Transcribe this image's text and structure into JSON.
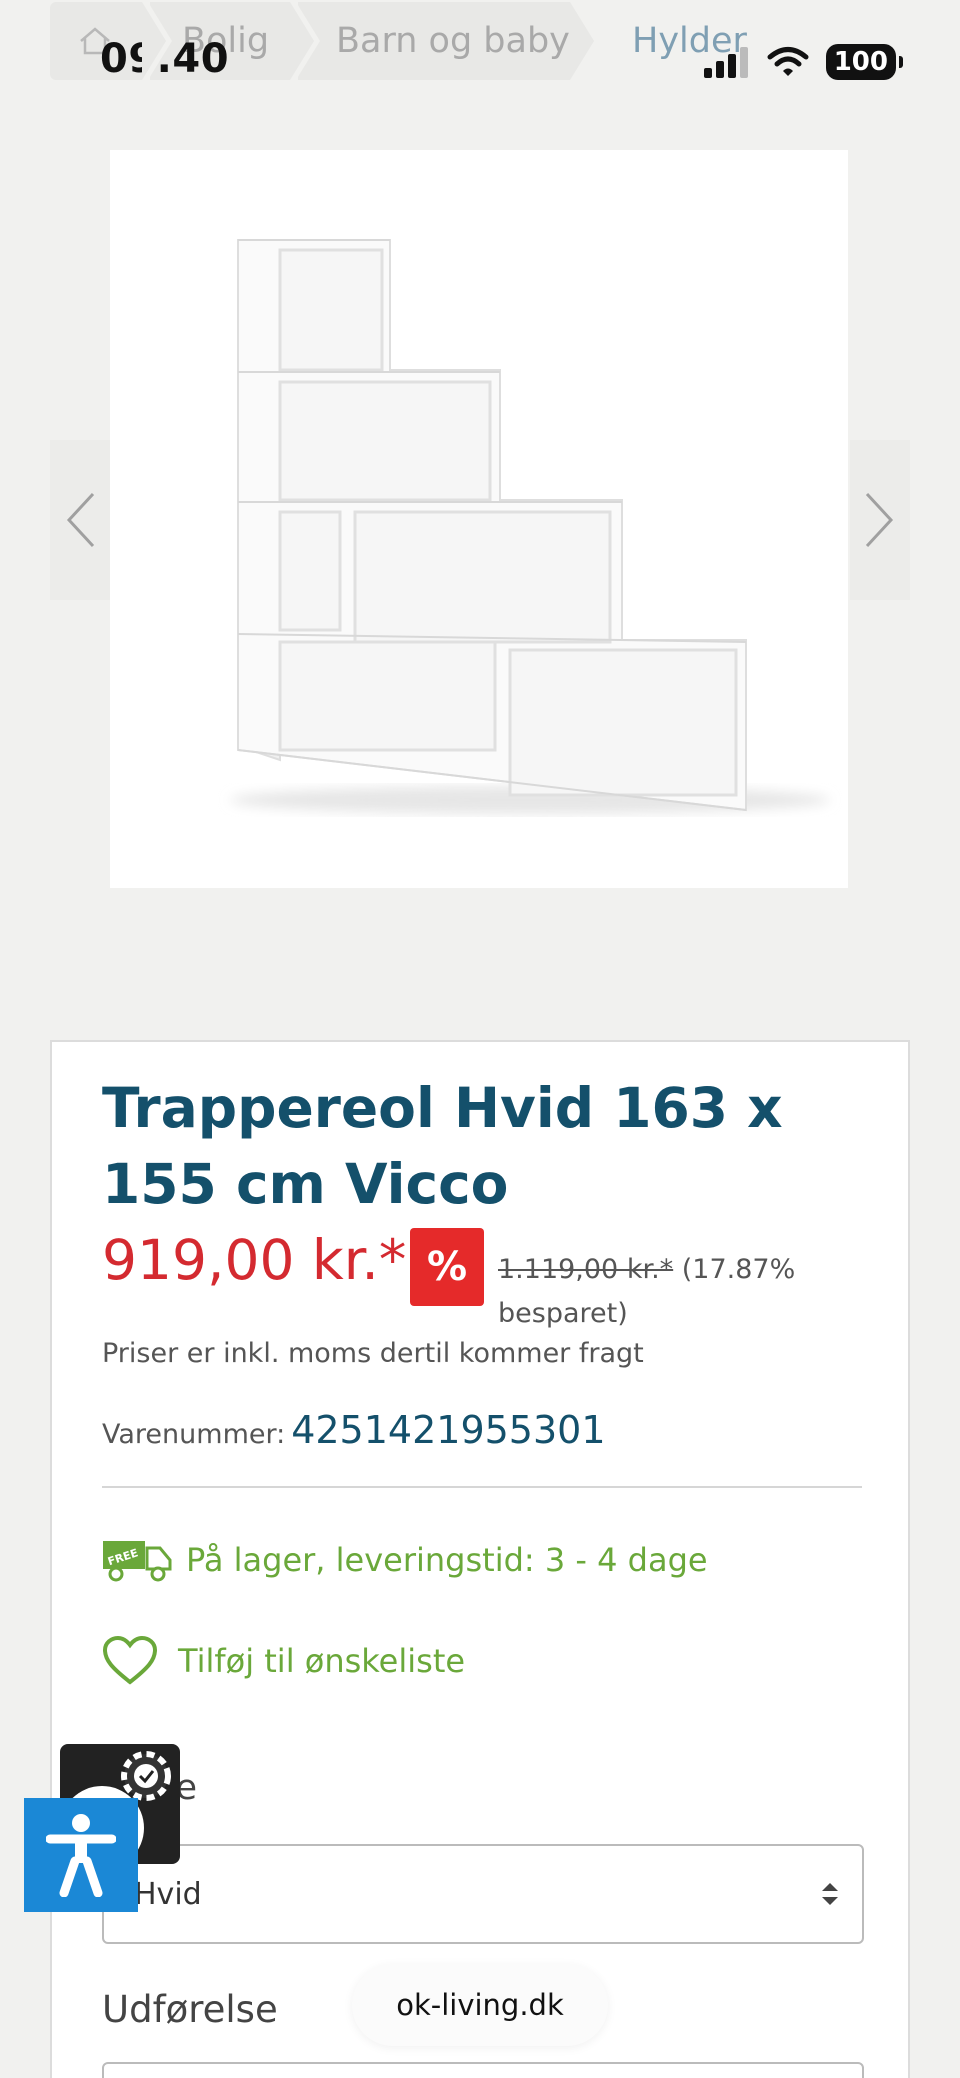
{
  "status_bar": {
    "time": "09.40",
    "battery": "100"
  },
  "breadcrumb": [
    {
      "label": ""
    },
    {
      "label": "Bolig"
    },
    {
      "label": "Barn og baby"
    },
    {
      "label": "Hylder"
    }
  ],
  "product": {
    "title": "Trappereol Hvid 163 x 155 cm Vicco",
    "price": "919,00 kr.*",
    "sale_badge": "%",
    "old_price": "1.119,00 kr.*",
    "saved": "(17.87% besparet)",
    "price_note": "Priser er inkl. moms dertil kommer fragt",
    "sku_label": "Varenummer:",
    "sku_value": "4251421955301",
    "stock_text": "På lager, leveringstid: 3 - 4 dage",
    "free_badge": "FREE",
    "wishlist_text": "Tilføj til ønskeliste",
    "color_label": "Farve",
    "color_value": "Hvid",
    "variant_label": "Udførelse"
  },
  "browser": {
    "domain": "ok-living.dk"
  },
  "colors": {
    "brand_blue": "#14506b",
    "price_red": "#d42a30",
    "stock_green": "#6aa83a",
    "a11y_blue": "#1b88d6"
  }
}
